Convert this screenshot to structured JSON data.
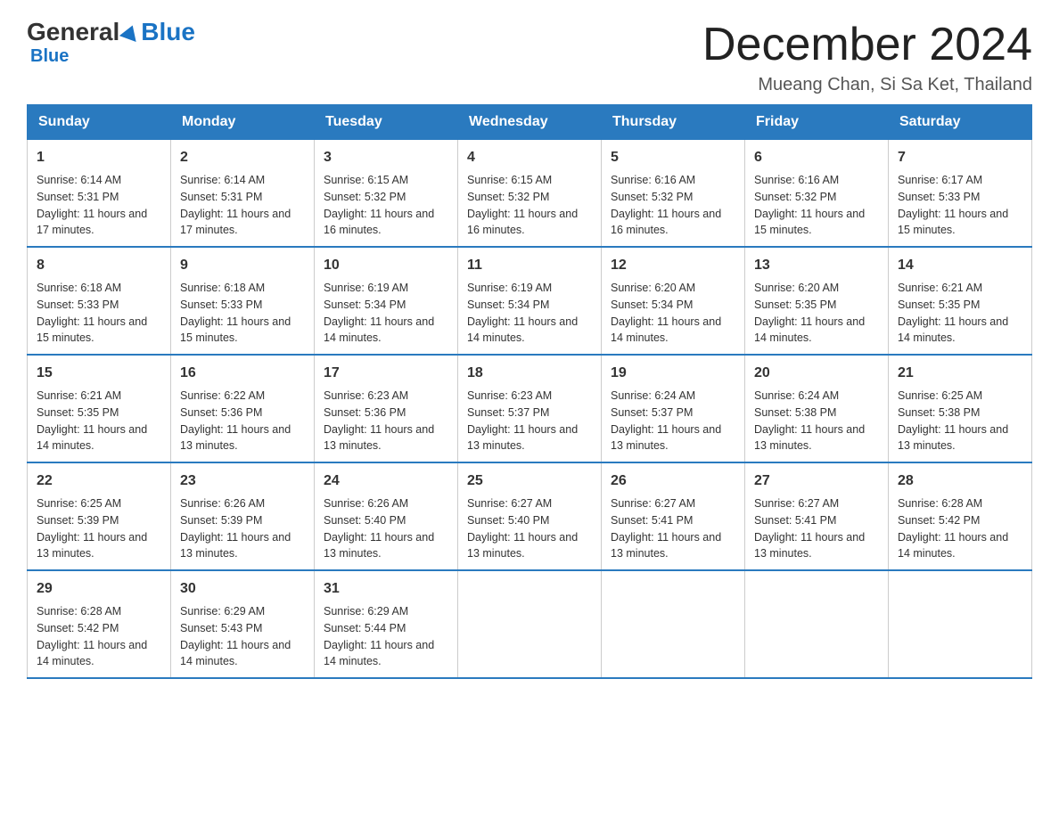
{
  "header": {
    "logo_general": "General",
    "logo_blue": "Blue",
    "month_title": "December 2024",
    "location": "Mueang Chan, Si Sa Ket, Thailand"
  },
  "days_of_week": [
    "Sunday",
    "Monday",
    "Tuesday",
    "Wednesday",
    "Thursday",
    "Friday",
    "Saturday"
  ],
  "weeks": [
    [
      {
        "day": "1",
        "sunrise": "6:14 AM",
        "sunset": "5:31 PM",
        "daylight": "11 hours and 17 minutes."
      },
      {
        "day": "2",
        "sunrise": "6:14 AM",
        "sunset": "5:31 PM",
        "daylight": "11 hours and 17 minutes."
      },
      {
        "day": "3",
        "sunrise": "6:15 AM",
        "sunset": "5:32 PM",
        "daylight": "11 hours and 16 minutes."
      },
      {
        "day": "4",
        "sunrise": "6:15 AM",
        "sunset": "5:32 PM",
        "daylight": "11 hours and 16 minutes."
      },
      {
        "day": "5",
        "sunrise": "6:16 AM",
        "sunset": "5:32 PM",
        "daylight": "11 hours and 16 minutes."
      },
      {
        "day": "6",
        "sunrise": "6:16 AM",
        "sunset": "5:32 PM",
        "daylight": "11 hours and 15 minutes."
      },
      {
        "day": "7",
        "sunrise": "6:17 AM",
        "sunset": "5:33 PM",
        "daylight": "11 hours and 15 minutes."
      }
    ],
    [
      {
        "day": "8",
        "sunrise": "6:18 AM",
        "sunset": "5:33 PM",
        "daylight": "11 hours and 15 minutes."
      },
      {
        "day": "9",
        "sunrise": "6:18 AM",
        "sunset": "5:33 PM",
        "daylight": "11 hours and 15 minutes."
      },
      {
        "day": "10",
        "sunrise": "6:19 AM",
        "sunset": "5:34 PM",
        "daylight": "11 hours and 14 minutes."
      },
      {
        "day": "11",
        "sunrise": "6:19 AM",
        "sunset": "5:34 PM",
        "daylight": "11 hours and 14 minutes."
      },
      {
        "day": "12",
        "sunrise": "6:20 AM",
        "sunset": "5:34 PM",
        "daylight": "11 hours and 14 minutes."
      },
      {
        "day": "13",
        "sunrise": "6:20 AM",
        "sunset": "5:35 PM",
        "daylight": "11 hours and 14 minutes."
      },
      {
        "day": "14",
        "sunrise": "6:21 AM",
        "sunset": "5:35 PM",
        "daylight": "11 hours and 14 minutes."
      }
    ],
    [
      {
        "day": "15",
        "sunrise": "6:21 AM",
        "sunset": "5:35 PM",
        "daylight": "11 hours and 14 minutes."
      },
      {
        "day": "16",
        "sunrise": "6:22 AM",
        "sunset": "5:36 PM",
        "daylight": "11 hours and 13 minutes."
      },
      {
        "day": "17",
        "sunrise": "6:23 AM",
        "sunset": "5:36 PM",
        "daylight": "11 hours and 13 minutes."
      },
      {
        "day": "18",
        "sunrise": "6:23 AM",
        "sunset": "5:37 PM",
        "daylight": "11 hours and 13 minutes."
      },
      {
        "day": "19",
        "sunrise": "6:24 AM",
        "sunset": "5:37 PM",
        "daylight": "11 hours and 13 minutes."
      },
      {
        "day": "20",
        "sunrise": "6:24 AM",
        "sunset": "5:38 PM",
        "daylight": "11 hours and 13 minutes."
      },
      {
        "day": "21",
        "sunrise": "6:25 AM",
        "sunset": "5:38 PM",
        "daylight": "11 hours and 13 minutes."
      }
    ],
    [
      {
        "day": "22",
        "sunrise": "6:25 AM",
        "sunset": "5:39 PM",
        "daylight": "11 hours and 13 minutes."
      },
      {
        "day": "23",
        "sunrise": "6:26 AM",
        "sunset": "5:39 PM",
        "daylight": "11 hours and 13 minutes."
      },
      {
        "day": "24",
        "sunrise": "6:26 AM",
        "sunset": "5:40 PM",
        "daylight": "11 hours and 13 minutes."
      },
      {
        "day": "25",
        "sunrise": "6:27 AM",
        "sunset": "5:40 PM",
        "daylight": "11 hours and 13 minutes."
      },
      {
        "day": "26",
        "sunrise": "6:27 AM",
        "sunset": "5:41 PM",
        "daylight": "11 hours and 13 minutes."
      },
      {
        "day": "27",
        "sunrise": "6:27 AM",
        "sunset": "5:41 PM",
        "daylight": "11 hours and 13 minutes."
      },
      {
        "day": "28",
        "sunrise": "6:28 AM",
        "sunset": "5:42 PM",
        "daylight": "11 hours and 14 minutes."
      }
    ],
    [
      {
        "day": "29",
        "sunrise": "6:28 AM",
        "sunset": "5:42 PM",
        "daylight": "11 hours and 14 minutes."
      },
      {
        "day": "30",
        "sunrise": "6:29 AM",
        "sunset": "5:43 PM",
        "daylight": "11 hours and 14 minutes."
      },
      {
        "day": "31",
        "sunrise": "6:29 AM",
        "sunset": "5:44 PM",
        "daylight": "11 hours and 14 minutes."
      },
      null,
      null,
      null,
      null
    ]
  ]
}
